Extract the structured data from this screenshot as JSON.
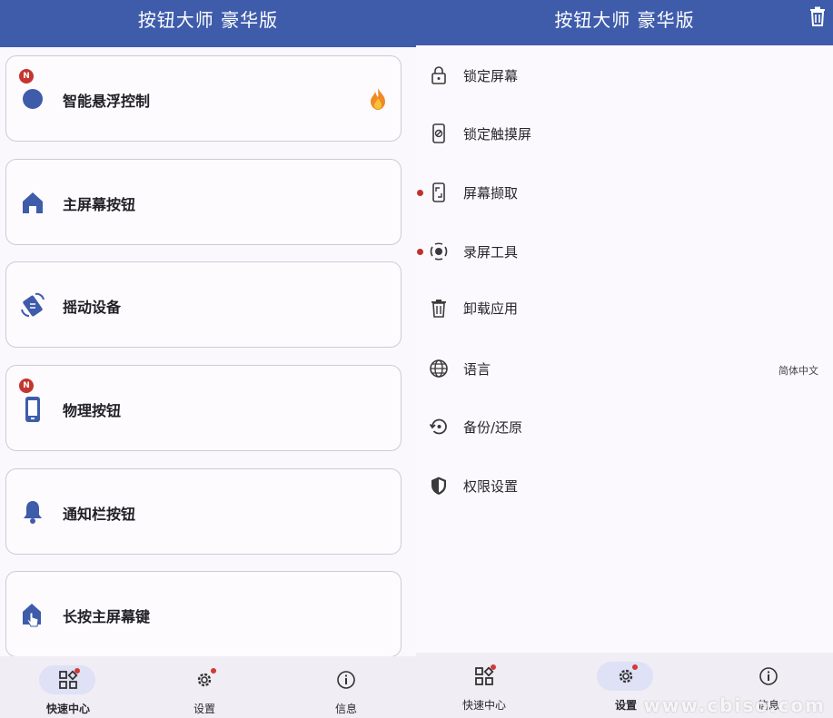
{
  "left": {
    "title": "按钮大师 豪华版",
    "cards": [
      {
        "label": "智能悬浮控制",
        "badge": "N",
        "icon": "circle-icon",
        "trailing": "fire-icon"
      },
      {
        "label": "主屏幕按钮",
        "icon": "home-icon"
      },
      {
        "label": "摇动设备",
        "icon": "shake-icon"
      },
      {
        "label": "物理按钮",
        "badge": "N",
        "icon": "phone-icon"
      },
      {
        "label": "通知栏按钮",
        "icon": "bell-icon"
      },
      {
        "label": "长按主屏幕键",
        "icon": "touch-home-icon"
      }
    ],
    "nav": [
      {
        "label": "快速中心",
        "icon": "dashboard-icon",
        "active": true
      },
      {
        "label": "设置",
        "icon": "gear-icon"
      },
      {
        "label": "信息",
        "icon": "info-icon"
      }
    ]
  },
  "right": {
    "title": "按钮大师 豪华版",
    "settings": [
      {
        "label": "锁定屏幕",
        "icon": "lock-icon"
      },
      {
        "label": "锁定触摸屏",
        "icon": "touch-lock-icon"
      },
      {
        "label": "屏幕撷取",
        "icon": "screenshot-icon",
        "dot": true
      },
      {
        "label": "录屏工具",
        "icon": "record-icon",
        "dot": true
      },
      {
        "label": "卸载应用",
        "icon": "trash-icon"
      },
      {
        "label": "语言",
        "icon": "globe-icon",
        "value": "简体中文"
      },
      {
        "label": "备份/还原",
        "icon": "restore-icon"
      },
      {
        "label": "权限设置",
        "icon": "shield-icon"
      }
    ],
    "nav": [
      {
        "label": "快速中心",
        "icon": "dashboard-icon"
      },
      {
        "label": "设置",
        "icon": "gear-icon",
        "active": true
      },
      {
        "label": "信息",
        "icon": "info-icon"
      }
    ]
  },
  "watermark": "www.cbiso.com",
  "colors": {
    "primary": "#3f5cab",
    "badge": "#c5352f",
    "surface": "#fbf8fd",
    "nav_bg": "#f0edf4",
    "nav_pill": "#dfe1f6"
  }
}
